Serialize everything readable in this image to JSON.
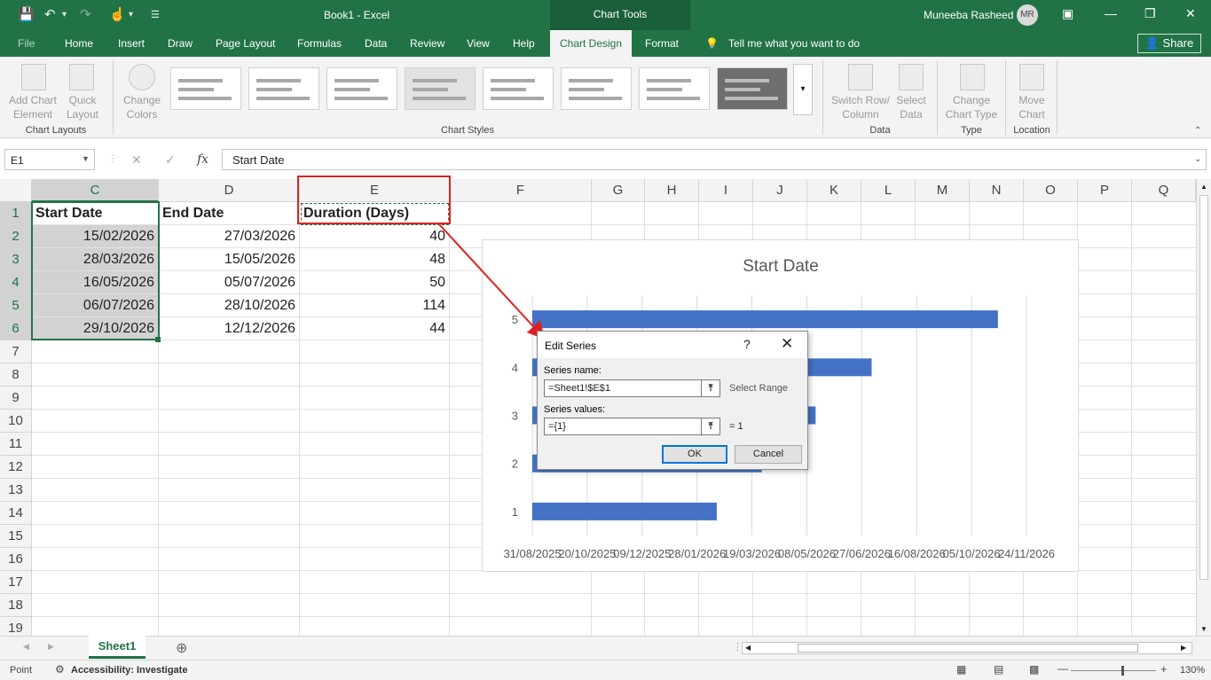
{
  "titlebar": {
    "title": "Book1  -  Excel",
    "context_tab_group": "Chart Tools",
    "user_name": "Muneeba Rasheed",
    "user_initials": "MR"
  },
  "tabs": {
    "file": "File",
    "home": "Home",
    "insert": "Insert",
    "draw": "Draw",
    "page_layout": "Page Layout",
    "formulas": "Formulas",
    "data": "Data",
    "review": "Review",
    "view": "View",
    "help": "Help",
    "chart_design": "Chart Design",
    "format": "Format",
    "tell_me": "Tell me what you want to do",
    "share": "Share"
  },
  "ribbon": {
    "add_chart_element_1": "Add Chart",
    "add_chart_element_2": "Element",
    "quick_layout_1": "Quick",
    "quick_layout_2": "Layout",
    "change_colors_1": "Change",
    "change_colors_2": "Colors",
    "switch_row_col_1": "Switch Row/",
    "switch_row_col_2": "Column",
    "select_data_1": "Select",
    "select_data_2": "Data",
    "change_chart_type_1": "Change",
    "change_chart_type_2": "Chart Type",
    "move_chart_1": "Move",
    "move_chart_2": "Chart",
    "group_chart_layouts": "Chart Layouts",
    "group_chart_styles": "Chart Styles",
    "group_data": "Data",
    "group_type": "Type",
    "group_location": "Location"
  },
  "formula_bar": {
    "namebox": "E1",
    "fx": "fx",
    "content": "Start Date"
  },
  "columns": [
    "C",
    "D",
    "E",
    "F",
    "G",
    "H",
    "I",
    "J",
    "K",
    "L",
    "M",
    "N",
    "O",
    "P",
    "Q"
  ],
  "rows": [
    "1",
    "2",
    "3",
    "4",
    "5",
    "6",
    "7",
    "8",
    "9",
    "10",
    "11",
    "12",
    "13",
    "14",
    "15",
    "16",
    "17",
    "18",
    "19"
  ],
  "cells": {
    "header": {
      "c": "Start Date",
      "d": "End Date",
      "e": "Duration (Days)"
    },
    "data": [
      {
        "c": "15/02/2026",
        "d": "27/03/2026",
        "e": "40"
      },
      {
        "c": "28/03/2026",
        "d": "15/05/2026",
        "e": "48"
      },
      {
        "c": "16/05/2026",
        "d": "05/07/2026",
        "e": "50"
      },
      {
        "c": "06/07/2026",
        "d": "28/10/2026",
        "e": "114"
      },
      {
        "c": "29/10/2026",
        "d": "12/12/2026",
        "e": "44"
      }
    ]
  },
  "chart_data": {
    "type": "bar",
    "title": "Start Date",
    "categories": [
      "1",
      "2",
      "3",
      "4",
      "5"
    ],
    "series": [
      {
        "values": [
          "2026-02-15",
          "2026-03-28",
          "2026-05-16",
          "2026-07-06",
          "2026-10-29"
        ]
      }
    ],
    "x_tick_labels": [
      "31/08/2025",
      "20/10/2025",
      "09/12/2025",
      "28/01/2026",
      "19/03/2026",
      "08/05/2026",
      "27/06/2026",
      "16/08/2026",
      "05/10/2026",
      "24/11/2026"
    ],
    "xlim": [
      "2025-08-31",
      "2026-11-24"
    ],
    "grid": true,
    "bar_color": "#4472c4"
  },
  "dialog": {
    "title": "Edit Series",
    "help": "?",
    "close": "✕",
    "series_name_label": "Series name:",
    "series_name_value": "=Sheet1!$E$1",
    "select_range": "Select Range",
    "series_values_label": "Series values:",
    "series_values_value": "={1}",
    "series_values_result": "= 1",
    "ok": "OK",
    "cancel": "Cancel"
  },
  "sheet_tab": "Sheet1",
  "status": {
    "ready": "Point",
    "accessibility": "Accessibility: Investigate",
    "zoom": "130%"
  },
  "colors": {
    "excel_green": "#217346",
    "annotation_red": "#e02020",
    "bar_blue": "#4472c4"
  }
}
